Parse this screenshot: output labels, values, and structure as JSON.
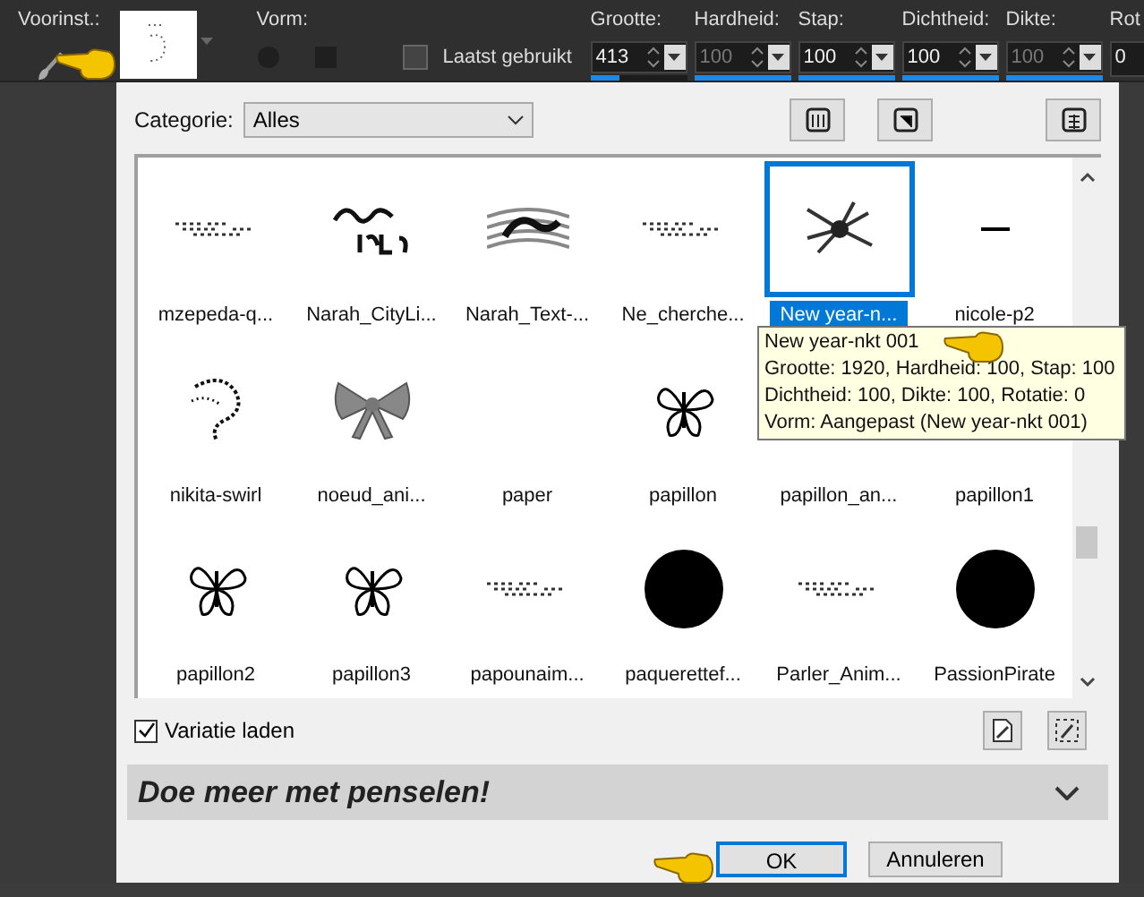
{
  "toolbar": {
    "preset_label": "Voorinst.:",
    "shape_label": "Vorm:",
    "last_used": {
      "label": "Laatst gebruikt",
      "checked": false
    },
    "spinners": [
      {
        "label": "Grootte:",
        "value": "413",
        "level": 0.3,
        "disabled": false
      },
      {
        "label": "Hardheid:",
        "value": "100",
        "level": 1,
        "disabled": true
      },
      {
        "label": "Stap:",
        "value": "100",
        "level": 1,
        "disabled": false
      },
      {
        "label": "Dichtheid:",
        "value": "100",
        "level": 1,
        "disabled": false
      },
      {
        "label": "Dikte:",
        "value": "100",
        "level": 1,
        "disabled": true
      },
      {
        "label": "Rot",
        "value": "0",
        "disabled": false
      }
    ]
  },
  "dialog": {
    "category_label": "Categorie:",
    "category_value": "Alles",
    "brushes": [
      {
        "label": "mzepeda-q...",
        "kind": "specks",
        "selected": false
      },
      {
        "label": "Narah_CityLi...",
        "kind": "script",
        "selected": false
      },
      {
        "label": "Narah_Text-...",
        "kind": "wave",
        "selected": false
      },
      {
        "label": "Ne_cherche...",
        "kind": "specks",
        "selected": false
      },
      {
        "label": "New year-n...",
        "kind": "burst",
        "selected": true
      },
      {
        "label": "nicole-p2",
        "kind": "line",
        "selected": false
      },
      {
        "label": "nikita-swirl",
        "kind": "swirl",
        "selected": false
      },
      {
        "label": "noeud_ani...",
        "kind": "bow",
        "selected": false
      },
      {
        "label": "paper",
        "kind": "blank",
        "selected": false
      },
      {
        "label": "papillon",
        "kind": "butterfly",
        "selected": false
      },
      {
        "label": "papillon_an...",
        "kind": "blank",
        "selected": false
      },
      {
        "label": "papillon1",
        "kind": "blank",
        "selected": false
      },
      {
        "label": "papillon2",
        "kind": "butterfly",
        "selected": false
      },
      {
        "label": "papillon3",
        "kind": "butterfly",
        "selected": false
      },
      {
        "label": "papounaim...",
        "kind": "specks",
        "selected": false
      },
      {
        "label": "paquerettef...",
        "kind": "dot",
        "selected": false
      },
      {
        "label": "Parler_Anim...",
        "kind": "specks",
        "selected": false
      },
      {
        "label": "PassionPirate",
        "kind": "dot",
        "selected": false
      }
    ],
    "tooltip": [
      "New year-nkt 001",
      "Grootte: 1920, Hardheid: 100, Stap: 100",
      "Dichtheid: 100, Dikte: 100, Rotatie: 0",
      "Vorm: Aangepast (New year-nkt 001)"
    ],
    "variation": {
      "label": "Variatie laden",
      "checked": true
    },
    "banner": "Doe meer met penselen!",
    "buttons": [
      {
        "label": "OK",
        "selected": true
      },
      {
        "label": "Annuleren",
        "selected": false
      }
    ]
  }
}
